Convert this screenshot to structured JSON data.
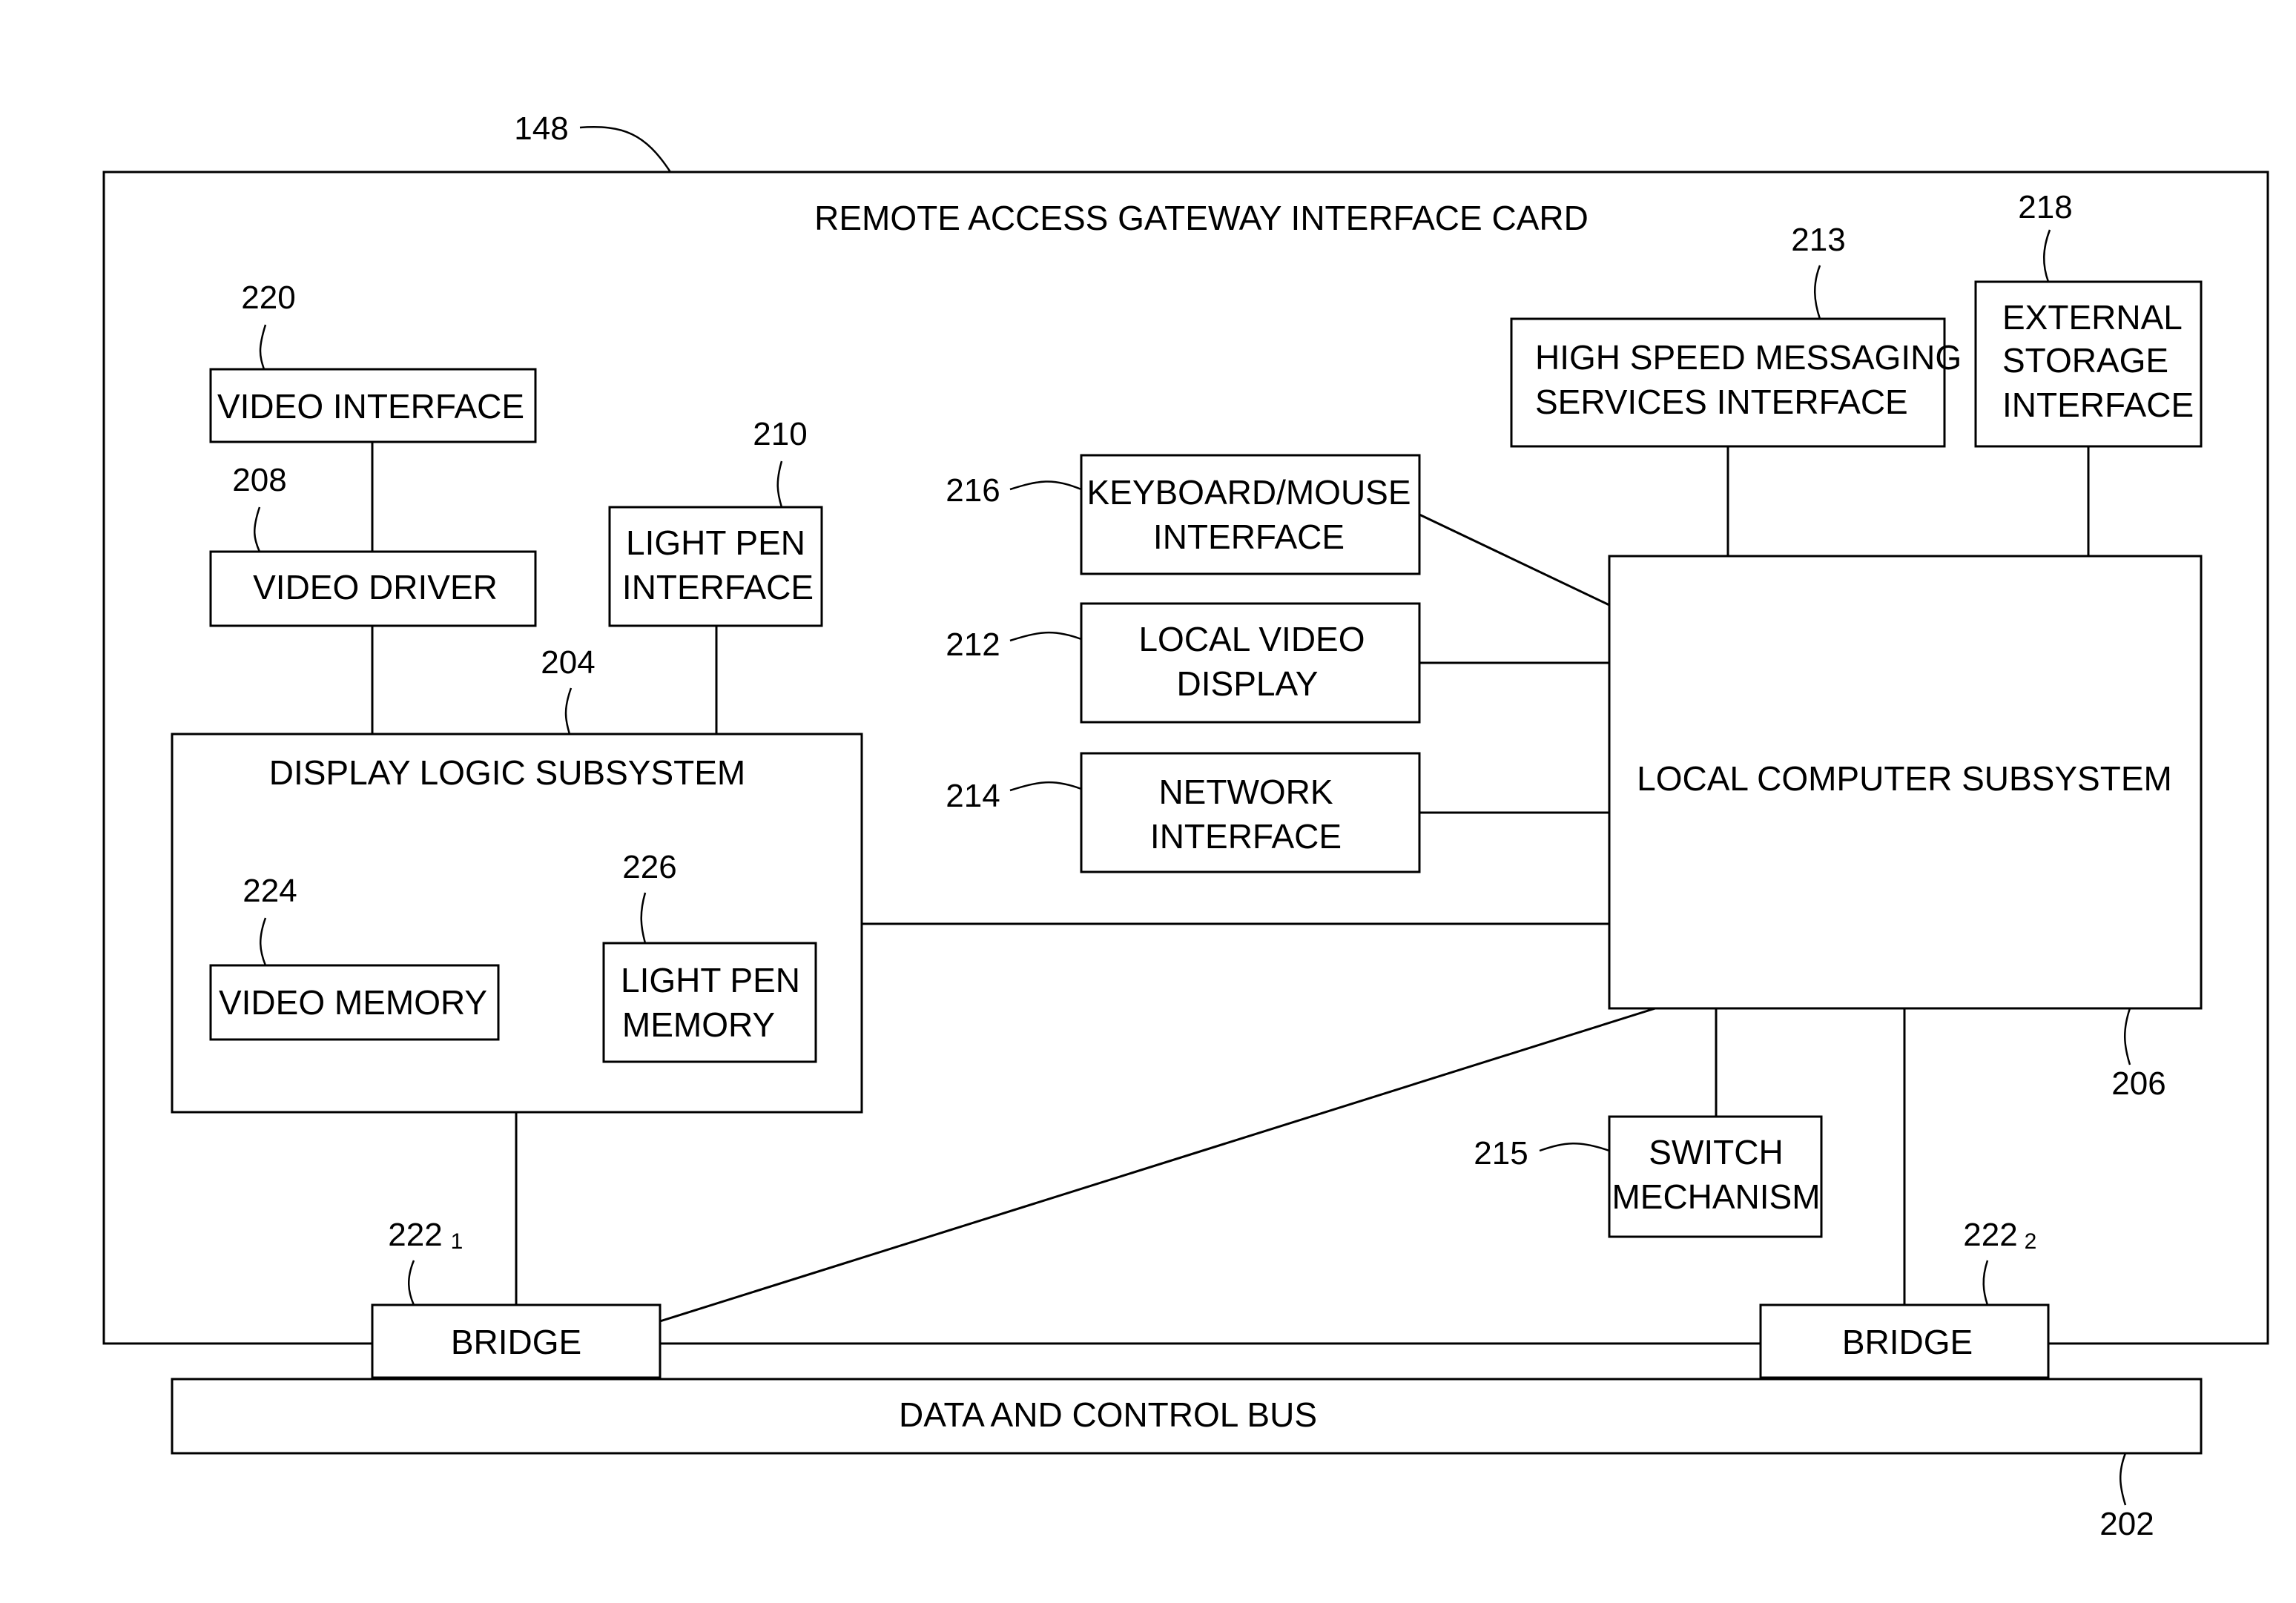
{
  "diagram": {
    "card_title": "REMOTE ACCESS GATEWAY INTERFACE CARD",
    "card_ref": "148",
    "blocks": {
      "video_interface": {
        "label": [
          "VIDEO INTERFACE"
        ],
        "ref": "220"
      },
      "video_driver": {
        "label": [
          "VIDEO DRIVER"
        ],
        "ref": "208"
      },
      "light_pen_interface": {
        "label": [
          "LIGHT PEN",
          "INTERFACE"
        ],
        "ref": "210"
      },
      "display_logic": {
        "label": [
          "DISPLAY LOGIC SUBSYSTEM"
        ],
        "ref": "204"
      },
      "video_memory": {
        "label": [
          "VIDEO MEMORY"
        ],
        "ref": "224"
      },
      "light_pen_memory": {
        "label": [
          "LIGHT PEN",
          "MEMORY"
        ],
        "ref": "226"
      },
      "keyboard_mouse": {
        "label": [
          "KEYBOARD/MOUSE",
          "INTERFACE"
        ],
        "ref": "216"
      },
      "local_video_display": {
        "label": [
          "LOCAL VIDEO",
          "DISPLAY"
        ],
        "ref": "212"
      },
      "network_interface": {
        "label": [
          "NETWORK",
          "INTERFACE"
        ],
        "ref": "214"
      },
      "high_speed_messaging": {
        "label": [
          "HIGH SPEED MESSAGING",
          "SERVICES INTERFACE"
        ],
        "ref": "213"
      },
      "external_storage": {
        "label": [
          "EXTERNAL",
          "STORAGE",
          "INTERFACE"
        ],
        "ref": "218"
      },
      "local_computer": {
        "label": [
          "LOCAL COMPUTER SUBSYSTEM"
        ],
        "ref": "206"
      },
      "switch_mechanism": {
        "label": [
          "SWITCH",
          "MECHANISM"
        ],
        "ref": "215"
      },
      "bridge_1": {
        "label": [
          "BRIDGE"
        ],
        "ref": "222",
        "sub": "1"
      },
      "bridge_2": {
        "label": [
          "BRIDGE"
        ],
        "ref": "222",
        "sub": "2"
      },
      "bus": {
        "label": [
          "DATA AND CONTROL BUS"
        ],
        "ref": "202"
      }
    }
  }
}
